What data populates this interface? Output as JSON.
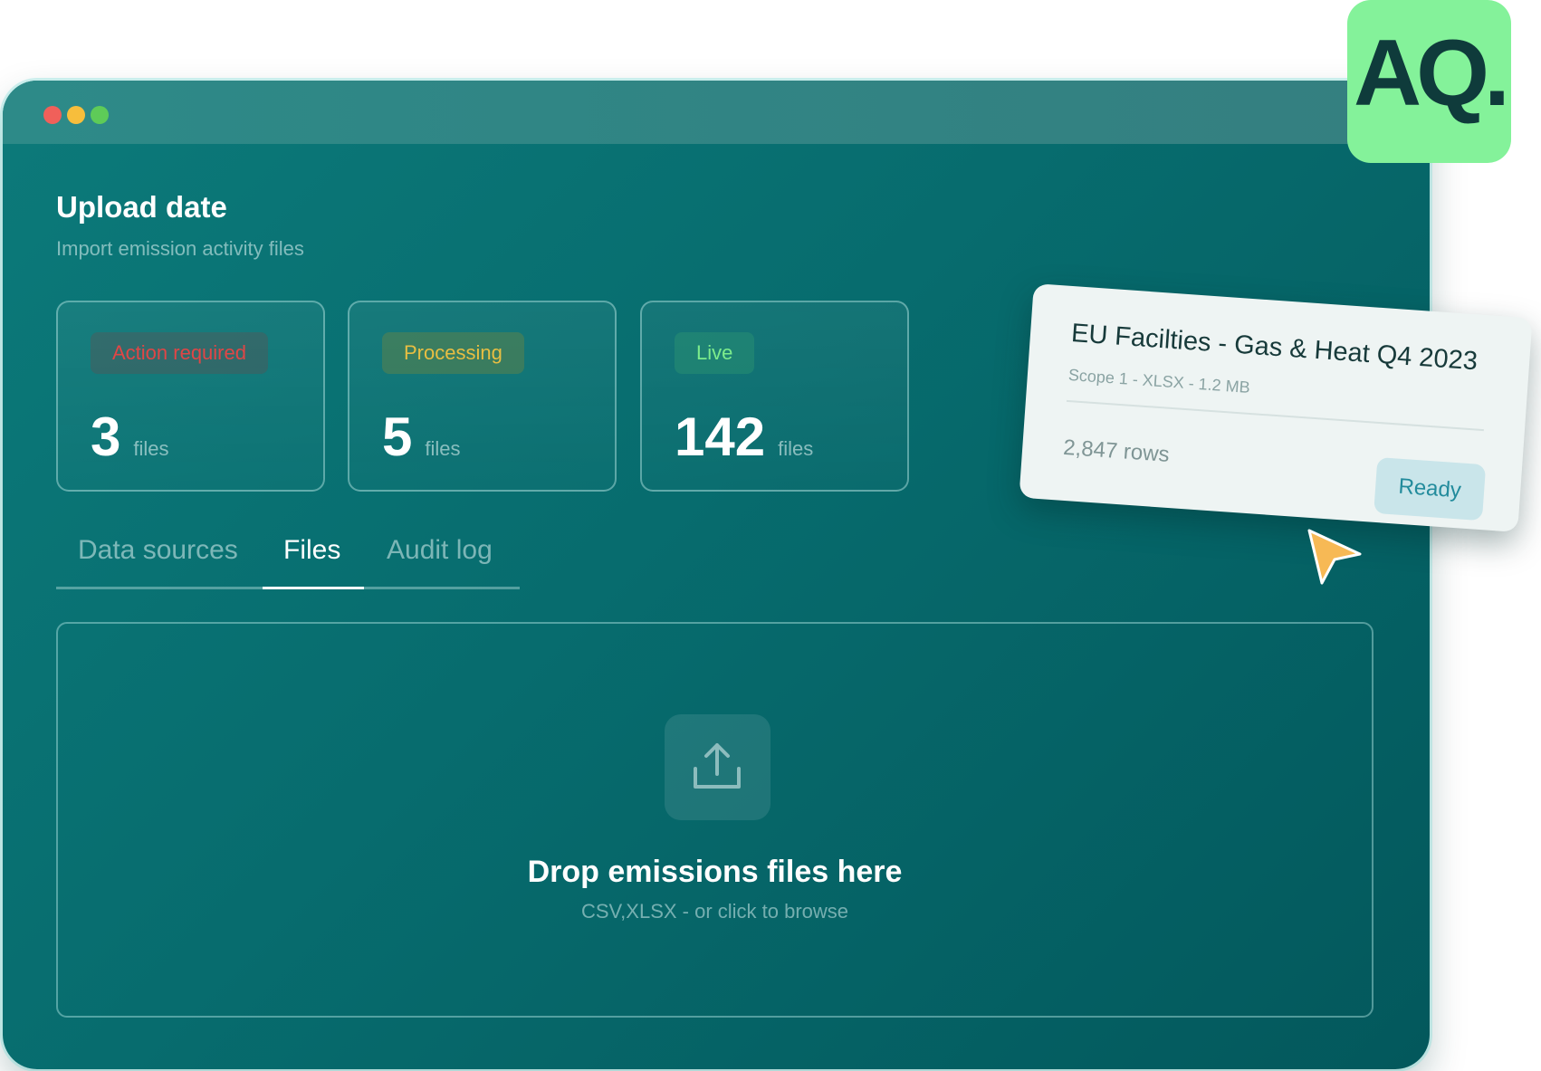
{
  "logo": {
    "text": "AQ.",
    "color": "#84f29a"
  },
  "window": {
    "controls": [
      "close",
      "minimize",
      "maximize"
    ]
  },
  "header": {
    "title": "Upload date",
    "subtitle": "Import emission activity files"
  },
  "stats": [
    {
      "badge": "Action required",
      "value": "3",
      "unit": "files",
      "color": "#e04646"
    },
    {
      "badge": "Processing",
      "value": "5",
      "unit": "files",
      "color": "#e8be42"
    },
    {
      "badge": "Live",
      "value": "142",
      "unit": "files",
      "color": "#7dec8c"
    }
  ],
  "tabs": [
    {
      "label": "Data sources",
      "active": false
    },
    {
      "label": "Files",
      "active": true
    },
    {
      "label": "Audit log",
      "active": false
    }
  ],
  "dropzone": {
    "icon": "upload-icon",
    "title": "Drop emissions files here",
    "subtitle": "CSV,XLSX - or click to browse"
  },
  "file_card": {
    "title": "EU Facilties - Gas & Heat Q4 2023",
    "meta": "Scope 1 - XLSX - 1.2 MB",
    "rows": "2,847 rows",
    "status": "Ready"
  },
  "cursor": {
    "icon": "pointer-arrow-icon",
    "color": "#f7b955"
  }
}
